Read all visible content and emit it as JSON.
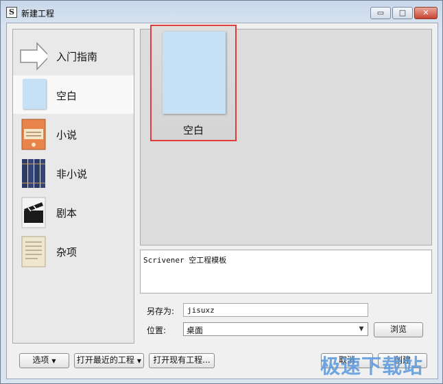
{
  "window": {
    "title": "新建工程",
    "app_icon_glyph": "S",
    "controls": {
      "minimize": "▭",
      "maximize": "□",
      "close": "✕"
    }
  },
  "sidebar": {
    "items": [
      {
        "label": "入门指南",
        "icon": "arrow-icon",
        "selected": false
      },
      {
        "label": "空白",
        "icon": "blank-page-icon",
        "selected": true
      },
      {
        "label": "小说",
        "icon": "novel-book-icon",
        "selected": false
      },
      {
        "label": "非小说",
        "icon": "bookshelf-icon",
        "selected": false
      },
      {
        "label": "剧本",
        "icon": "clapperboard-icon",
        "selected": false
      },
      {
        "label": "杂项",
        "icon": "paper-icon",
        "selected": false
      }
    ]
  },
  "templates": [
    {
      "label": "空白",
      "selected": true
    }
  ],
  "description": "Scrivener 空工程模板",
  "form": {
    "save_as_label": "另存为:",
    "save_as_value": "jisuxz",
    "location_label": "位置:",
    "location_value": "桌面",
    "browse_label": "浏览"
  },
  "footer": {
    "options_label": "选项",
    "open_recent_label": "打开最近的工程",
    "open_existing_label": "打开现有工程...",
    "cancel_label": "取消",
    "create_label": "创建"
  },
  "watermark": "极速下载站",
  "colors": {
    "selection_outline": "#e03a3a",
    "blank_page": "#c6e0f6"
  }
}
